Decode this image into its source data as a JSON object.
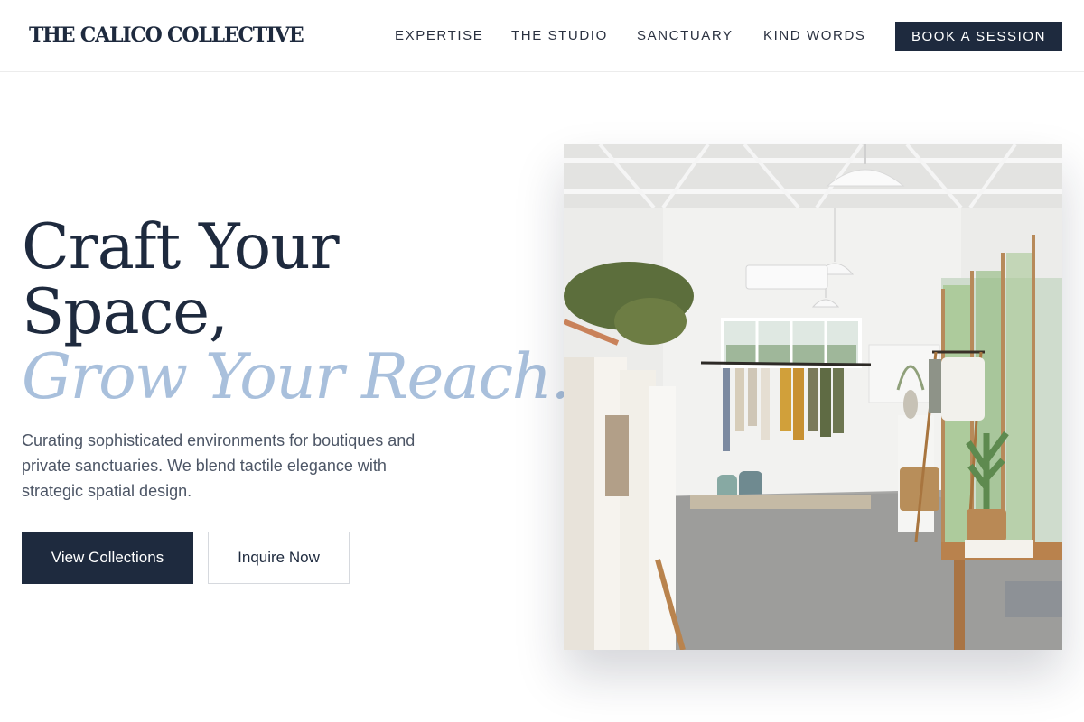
{
  "header": {
    "logo": "THE CALICO COLLECTIVE",
    "nav": [
      {
        "label": "EXPERTISE"
      },
      {
        "label": "THE STUDIO"
      },
      {
        "label": "SANCTUARY"
      },
      {
        "label": "KIND WORDS"
      }
    ],
    "cta_label": "BOOK A SESSION"
  },
  "hero": {
    "title_line1": "Craft Your",
    "title_line2": "Space,",
    "title_accent": "Grow Your Reach.",
    "description": "Curating sophisticated environments for boutiques and private sanctuaries. We blend tactile elegance with strategic spatial design.",
    "primary_button": "View Collections",
    "secondary_button": "Inquire Now"
  },
  "colors": {
    "navy": "#1e2a3e",
    "accent_blue": "#a9c0dc",
    "body_text": "#4d5666"
  }
}
